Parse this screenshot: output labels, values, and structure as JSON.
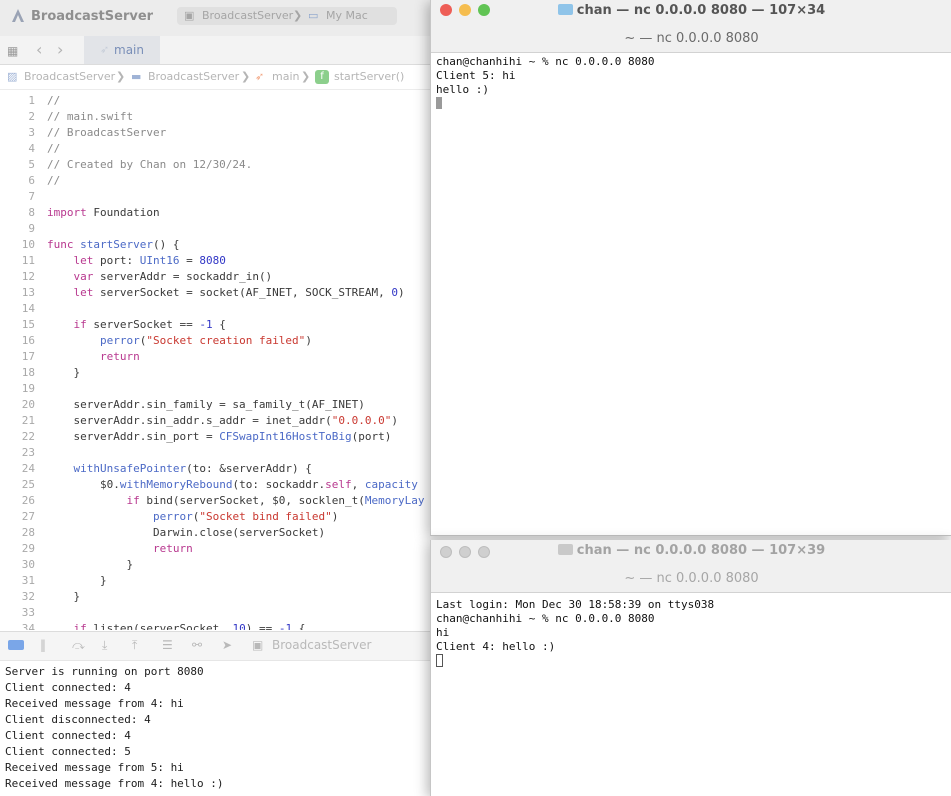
{
  "xcode": {
    "app_title": "BroadcastServer",
    "scheme": "BroadcastServer",
    "destination": "My Mac",
    "tab": "main",
    "jumpbar": [
      "BroadcastServer",
      "BroadcastServer",
      "main",
      "startServer()"
    ]
  },
  "code_lines": [
    [
      [
        "c-com",
        "//"
      ]
    ],
    [
      [
        "c-com",
        "// main.swift"
      ]
    ],
    [
      [
        "c-com",
        "// BroadcastServer"
      ]
    ],
    [
      [
        "c-com",
        "//"
      ]
    ],
    [
      [
        "c-com",
        "// Created by Chan on 12/30/24."
      ]
    ],
    [
      [
        "c-com",
        "//"
      ]
    ],
    [
      [
        "",
        ""
      ]
    ],
    [
      [
        "c-kw",
        "import"
      ],
      [
        "",
        " Foundation"
      ]
    ],
    [
      [
        "",
        ""
      ]
    ],
    [
      [
        "c-kw",
        "func"
      ],
      [
        "",
        " "
      ],
      [
        "c-fn",
        "startServer"
      ],
      [
        "",
        "() {"
      ]
    ],
    [
      [
        "",
        "    "
      ],
      [
        "c-kw",
        "let"
      ],
      [
        "",
        " port: "
      ],
      [
        "c-fn",
        "UInt16"
      ],
      [
        "",
        " = "
      ],
      [
        "c-num",
        "8080"
      ]
    ],
    [
      [
        "",
        "    "
      ],
      [
        "c-kw",
        "var"
      ],
      [
        "",
        " serverAddr = sockaddr_in()"
      ]
    ],
    [
      [
        "",
        "    "
      ],
      [
        "c-kw",
        "let"
      ],
      [
        "",
        " serverSocket = socket(AF_INET, SOCK_STREAM, "
      ],
      [
        "c-num",
        "0"
      ],
      [
        "",
        ")"
      ]
    ],
    [
      [
        "",
        ""
      ]
    ],
    [
      [
        "",
        "    "
      ],
      [
        "c-kw",
        "if"
      ],
      [
        "",
        " serverSocket == "
      ],
      [
        "c-num",
        "-1"
      ],
      [
        "",
        " {"
      ]
    ],
    [
      [
        "",
        "        "
      ],
      [
        "c-fn",
        "perror"
      ],
      [
        "",
        "("
      ],
      [
        "c-str",
        "\"Socket creation failed\""
      ],
      [
        "",
        ")"
      ]
    ],
    [
      [
        "",
        "        "
      ],
      [
        "c-kw",
        "return"
      ]
    ],
    [
      [
        "",
        "    }"
      ]
    ],
    [
      [
        "",
        ""
      ]
    ],
    [
      [
        "",
        "    serverAddr.sin_family = sa_family_t(AF_INET)"
      ]
    ],
    [
      [
        "",
        "    serverAddr.sin_addr.s_addr = inet_addr("
      ],
      [
        "c-str",
        "\"0.0.0.0\""
      ],
      [
        "",
        ")"
      ]
    ],
    [
      [
        "",
        "    serverAddr.sin_port = "
      ],
      [
        "c-fn",
        "CFSwapInt16HostToBig"
      ],
      [
        "",
        "(port)"
      ]
    ],
    [
      [
        "",
        ""
      ]
    ],
    [
      [
        "",
        "    "
      ],
      [
        "c-fn",
        "withUnsafePointer"
      ],
      [
        "",
        "(to: &serverAddr) {"
      ]
    ],
    [
      [
        "",
        "        $0."
      ],
      [
        "c-fn",
        "withMemoryRebound"
      ],
      [
        "",
        "(to: sockaddr."
      ],
      [
        "c-kw",
        "self"
      ],
      [
        "",
        ", "
      ],
      [
        "c-fn",
        "capacity"
      ]
    ],
    [
      [
        "",
        "            "
      ],
      [
        "c-kw",
        "if"
      ],
      [
        "",
        " bind(serverSocket, $0, socklen_t("
      ],
      [
        "c-fn",
        "MemoryLay"
      ]
    ],
    [
      [
        "",
        "                "
      ],
      [
        "c-fn",
        "perror"
      ],
      [
        "",
        "("
      ],
      [
        "c-str",
        "\"Socket bind failed\""
      ],
      [
        "",
        ")"
      ]
    ],
    [
      [
        "",
        "                Darwin.close(serverSocket)"
      ]
    ],
    [
      [
        "",
        "                "
      ],
      [
        "c-kw",
        "return"
      ]
    ],
    [
      [
        "",
        "            }"
      ]
    ],
    [
      [
        "",
        "        }"
      ]
    ],
    [
      [
        "",
        "    }"
      ]
    ],
    [
      [
        "",
        ""
      ]
    ],
    [
      [
        "",
        "    "
      ],
      [
        "c-kw",
        "if"
      ],
      [
        "",
        " listen(serverSocket, "
      ],
      [
        "c-num",
        "10"
      ],
      [
        "",
        ") == "
      ],
      [
        "c-num",
        "-1"
      ],
      [
        "",
        " {"
      ]
    ]
  ],
  "debug": {
    "target": "BroadcastServer",
    "console": [
      "Server is running on port 8080",
      "Client connected: 4",
      "Received message from 4: hi",
      "Client disconnected: 4",
      "Client connected: 4",
      "Client connected: 5",
      "Received message from 5: hi",
      "Received message from 4: hello :)"
    ]
  },
  "terminal1": {
    "title": "chan — nc 0.0.0.0 8080 — 107×34",
    "subtitle": "~ — nc 0.0.0.0 8080",
    "lines": [
      "chan@chanhihi ~ % nc 0.0.0.0 8080",
      "Client 5: hi",
      "hello :)"
    ]
  },
  "terminal2": {
    "title": "chan — nc 0.0.0.0 8080 — 107×39",
    "subtitle": "~ — nc 0.0.0.0 8080",
    "lines": [
      "Last login: Mon Dec 30 18:58:39 on ttys038",
      "chan@chanhihi ~ % nc 0.0.0.0 8080",
      "hi",
      "Client 4: hello :)"
    ]
  },
  "colors": {
    "close": "#ee5e56",
    "minimize": "#f5bd4f",
    "zoom": "#61c454",
    "inactive_light": "#cfcfcf"
  }
}
